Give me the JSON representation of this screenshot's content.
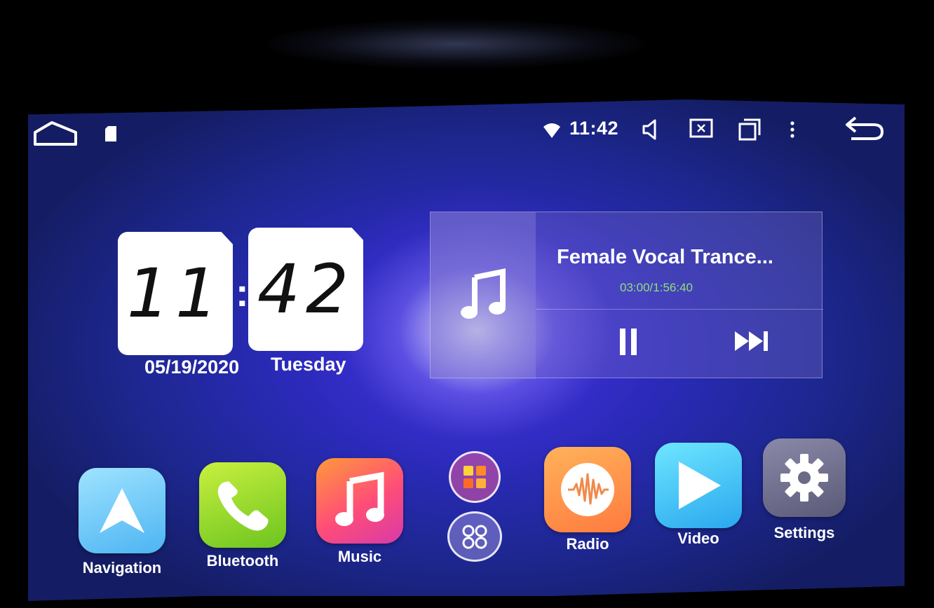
{
  "status_bar": {
    "time": "11:42",
    "icons": [
      "home-icon",
      "sd-card-icon",
      "wifi-icon",
      "volume-icon",
      "screenshot-icon",
      "recents-icon",
      "menu-icon",
      "back-icon"
    ]
  },
  "clock_widget": {
    "hours": "11",
    "colon": ":",
    "minutes": "42",
    "date": "05/19/2020",
    "day": "Tuesday"
  },
  "music_widget": {
    "title": "Female Vocal Trance...",
    "time": "03:00/1:56:40",
    "icons": [
      "music-note-icon",
      "pause-icon",
      "next-track-icon"
    ]
  },
  "apps": [
    {
      "label": "Navigation",
      "icon": "navigation-arrow-icon"
    },
    {
      "label": "Bluetooth",
      "icon": "phone-icon"
    },
    {
      "label": "Music",
      "icon": "music-note-icon"
    },
    {
      "label": "",
      "icon": "app-grid-icon"
    },
    {
      "label": "",
      "icon": "equalizer-icon"
    },
    {
      "label": "Radio",
      "icon": "radio-wave-icon"
    },
    {
      "label": "Video",
      "icon": "play-icon"
    },
    {
      "label": "Settings",
      "icon": "gear-icon"
    }
  ],
  "colors": {
    "background": "#1d2790",
    "time_progress": "#8fe07a"
  }
}
